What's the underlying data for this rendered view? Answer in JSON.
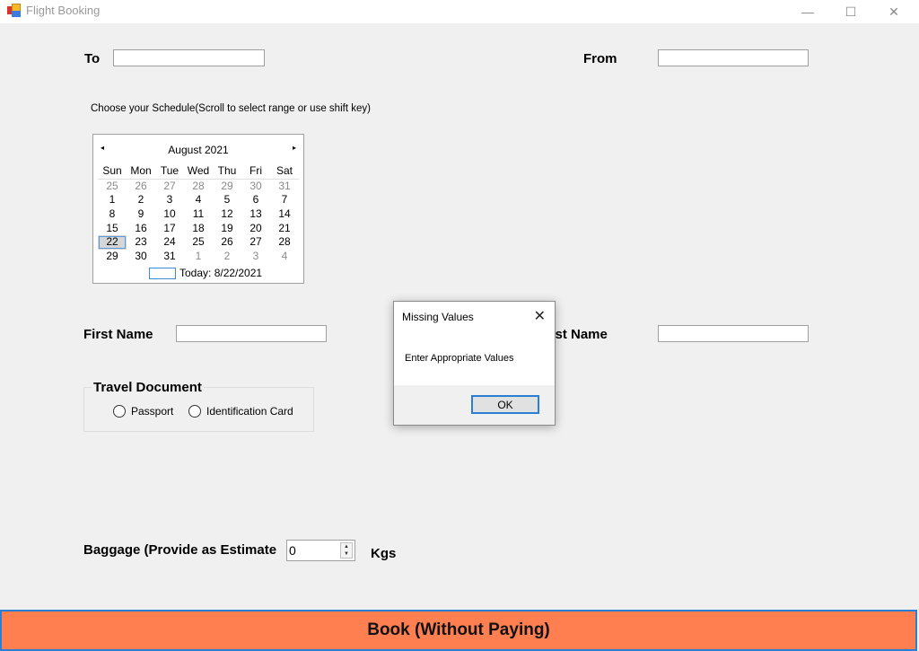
{
  "window": {
    "title": "Flight Booking",
    "controls": {
      "minimize": "—",
      "maximize": "☐",
      "close": "✕"
    }
  },
  "form": {
    "to_label": "To",
    "to_value": "",
    "from_label": "From",
    "from_value": "",
    "schedule_hint": "Choose your Schedule(Scroll to select range or use shift key)",
    "first_name_label": "First Name",
    "first_name_value": "",
    "last_name_label": "Last Name",
    "last_name_value": "",
    "travel_document": {
      "legend": "Travel Document",
      "options": [
        "Passport",
        "Identification Card"
      ],
      "selected": null
    },
    "baggage_label": "Baggage (Provide as Estimate",
    "baggage_value": "0",
    "baggage_unit": "Kgs",
    "book_button": "Book (Without Paying)"
  },
  "calendar": {
    "month_label": "August 2021",
    "prev_icon": "◂",
    "next_icon": "▸",
    "days_of_week": [
      "Sun",
      "Mon",
      "Tue",
      "Wed",
      "Thu",
      "Fri",
      "Sat"
    ],
    "weeks": [
      [
        {
          "d": "25",
          "o": true
        },
        {
          "d": "26",
          "o": true
        },
        {
          "d": "27",
          "o": true
        },
        {
          "d": "28",
          "o": true
        },
        {
          "d": "29",
          "o": true
        },
        {
          "d": "30",
          "o": true
        },
        {
          "d": "31",
          "o": true
        }
      ],
      [
        {
          "d": "1"
        },
        {
          "d": "2"
        },
        {
          "d": "3"
        },
        {
          "d": "4"
        },
        {
          "d": "5"
        },
        {
          "d": "6"
        },
        {
          "d": "7"
        }
      ],
      [
        {
          "d": "8"
        },
        {
          "d": "9"
        },
        {
          "d": "10"
        },
        {
          "d": "11"
        },
        {
          "d": "12"
        },
        {
          "d": "13"
        },
        {
          "d": "14"
        }
      ],
      [
        {
          "d": "15"
        },
        {
          "d": "16"
        },
        {
          "d": "17"
        },
        {
          "d": "18"
        },
        {
          "d": "19"
        },
        {
          "d": "20"
        },
        {
          "d": "21"
        }
      ],
      [
        {
          "d": "22",
          "s": true
        },
        {
          "d": "23"
        },
        {
          "d": "24"
        },
        {
          "d": "25"
        },
        {
          "d": "26"
        },
        {
          "d": "27"
        },
        {
          "d": "28"
        }
      ],
      [
        {
          "d": "29"
        },
        {
          "d": "30"
        },
        {
          "d": "31"
        },
        {
          "d": "1",
          "o": true
        },
        {
          "d": "2",
          "o": true
        },
        {
          "d": "3",
          "o": true
        },
        {
          "d": "4",
          "o": true
        }
      ]
    ],
    "today_label": "Today: 8/22/2021"
  },
  "dialog": {
    "title": "Missing Values",
    "message": "Enter Appropriate Values",
    "ok_label": "OK",
    "close_icon": "✕"
  },
  "colors": {
    "book_button_bg": "#ff7f50",
    "focus_border": "#2a7fd4",
    "form_bg": "#f0f0f0"
  }
}
